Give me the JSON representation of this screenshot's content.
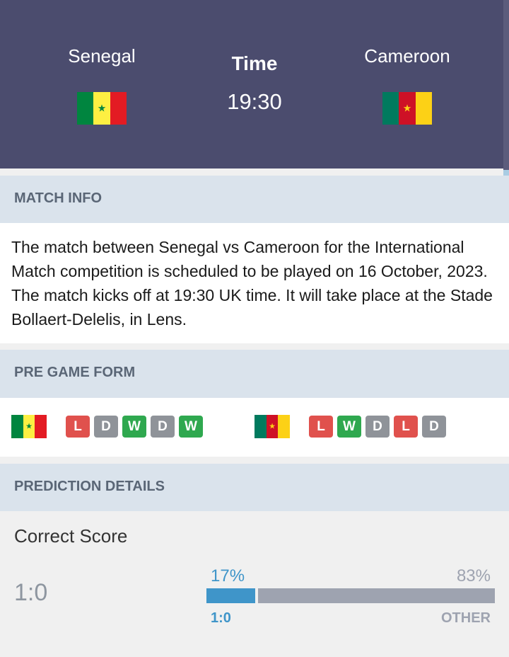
{
  "match": {
    "home": {
      "name": "Senegal",
      "flag_colors": [
        "#00853f",
        "#fdef42",
        "#e31b23"
      ],
      "star_color": "#00853f"
    },
    "away": {
      "name": "Cameroon",
      "flag_colors": [
        "#007a5e",
        "#ce1126",
        "#fcd116"
      ],
      "star_color": "#fcd116"
    },
    "time_label": "Time",
    "time_value": "19:30"
  },
  "match_info": {
    "heading": "MATCH INFO",
    "text": "The match between Senegal vs Cameroon for the International Match competition is scheduled to be played on 16 October, 2023. The match kicks off at 19:30 UK time. It will take place at the Stade Bollaert-Delelis, in Lens."
  },
  "pre_game_form": {
    "heading": "PRE GAME FORM",
    "home_form": [
      "L",
      "D",
      "W",
      "D",
      "W"
    ],
    "away_form": [
      "L",
      "W",
      "D",
      "L",
      "D"
    ]
  },
  "prediction": {
    "heading": "PREDICTION DETAILS",
    "correct_score_title": "Correct Score",
    "score": "1:0",
    "left_percent": "17%",
    "right_percent": "83%",
    "left_fraction": 0.17,
    "left_label": "1:0",
    "right_label": "OTHER",
    "left_color": "#3f95c9",
    "right_color": "#9ea3b0"
  }
}
